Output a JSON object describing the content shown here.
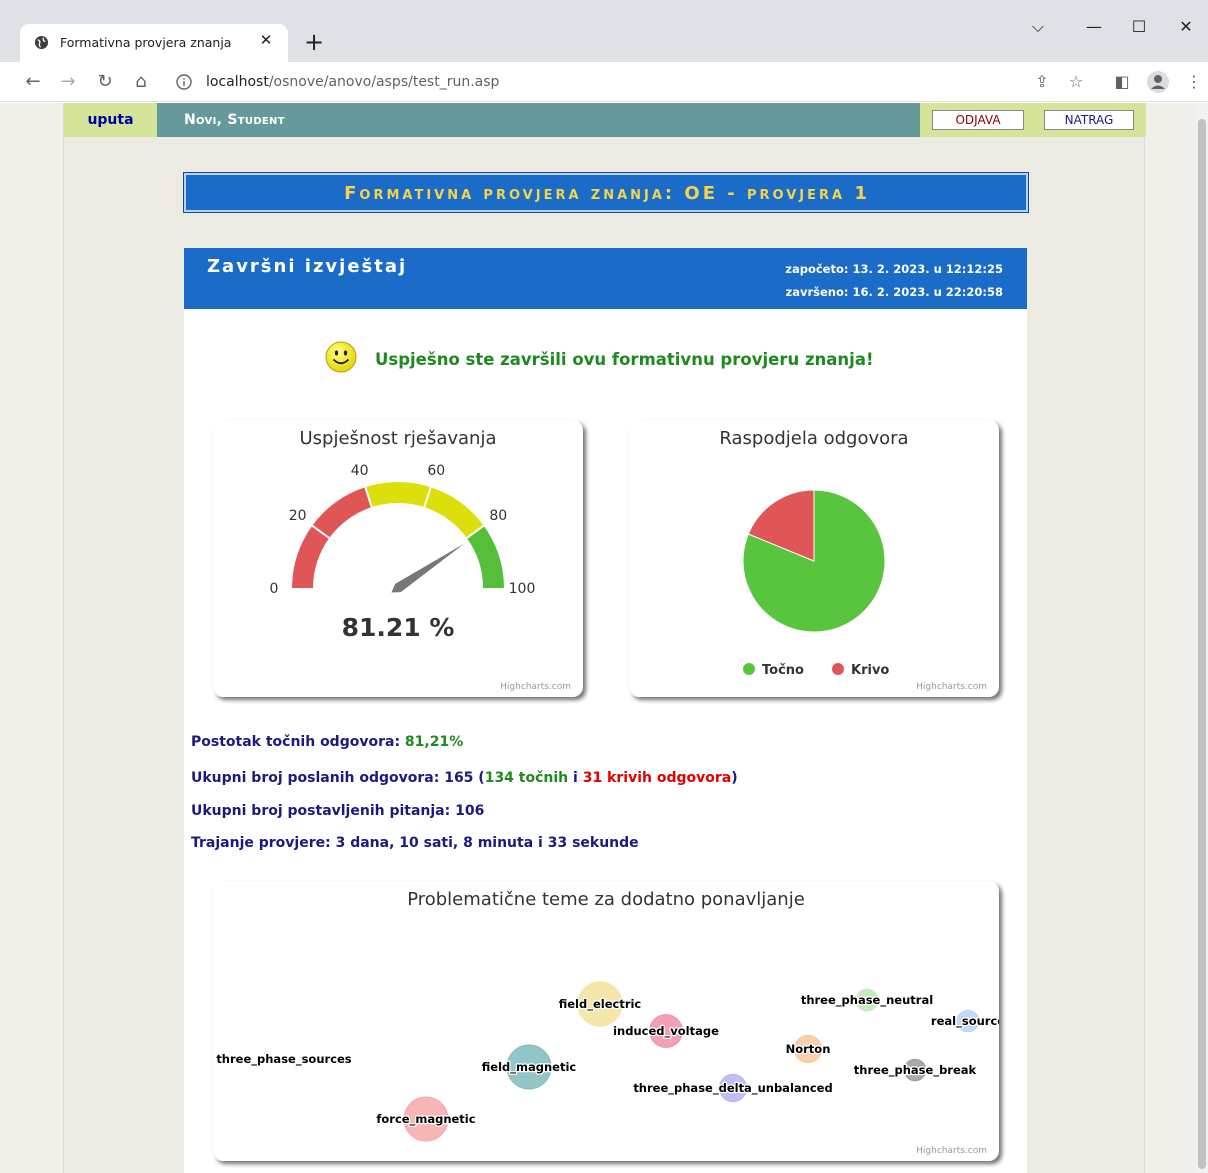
{
  "browser": {
    "tab_title": "Formativna provjera znanja",
    "url_host": "localhost",
    "url_path": "/osnove/anovo/asps/test_run.asp"
  },
  "nav": {
    "uputa": "uputa",
    "user": "Novi, Student",
    "odjava": "ODJAVA",
    "natrag": "NATRAG"
  },
  "banner": "Formativna provjera znanja: OE - provjera 1",
  "report": {
    "title": "Završni izvještaj",
    "started": "započeto: 13. 2. 2023. u 12:12:25",
    "finished": "završeno: 16. 2. 2023. u 22:20:58",
    "success_message": "Uspješno ste završili ovu formativnu provjeru znanja!",
    "stats": {
      "pct_label": "Postotak točnih odgovora: ",
      "pct_value": "81,21%",
      "sent_label": "Ukupni broj poslanih odgovora: 165 (",
      "sent_correct": "134 točnih",
      "sent_mid": " i ",
      "sent_wrong": "31 krivih odgovora",
      "sent_end": ")",
      "questions": "Ukupni broj postavljenih pitanja: 106",
      "duration": "Trajanje provjere: 3 dana, 10 sati, 8 minuta i 33 sekunde"
    }
  },
  "credits": "Highcharts.com",
  "chart_data": [
    {
      "type": "gauge",
      "title": "Uspješnost rješavanja",
      "value": 81.21,
      "value_label": "81.21 %",
      "min": 0,
      "max": 100,
      "ticks": [
        "0",
        "20",
        "40",
        "60",
        "80",
        "100"
      ],
      "bands": [
        {
          "from": 0,
          "to": 40,
          "color": "#e05555"
        },
        {
          "from": 40,
          "to": 80,
          "color": "#dddf0d"
        },
        {
          "from": 80,
          "to": 100,
          "color": "#55bf3b"
        }
      ]
    },
    {
      "type": "pie",
      "title": "Raspodjela odgovora",
      "slices": [
        {
          "name": "Točno",
          "value": 134,
          "color": "#59c43d"
        },
        {
          "name": "Krivo",
          "value": 31,
          "color": "#e05555"
        }
      ]
    },
    {
      "type": "packed-bubble",
      "title": "Problematične teme za dodatno ponavljanje",
      "bubbles": [
        {
          "name": "three_phase_sources",
          "value": 0,
          "color": "#ffffff"
        },
        {
          "name": "force_magnetic",
          "value": 5,
          "color": "#f7a8aa"
        },
        {
          "name": "field_magnetic",
          "value": 5,
          "color": "#7fbcbc"
        },
        {
          "name": "field_electric",
          "value": 5,
          "color": "#f2e39a"
        },
        {
          "name": "induced_voltage",
          "value": 3,
          "color": "#f08fa8"
        },
        {
          "name": "three_phase_delta_unbalanced",
          "value": 2,
          "color": "#b4b4f2"
        },
        {
          "name": "Norton",
          "value": 2,
          "color": "#f8c898"
        },
        {
          "name": "three_phase_neutral",
          "value": 1,
          "color": "#bde8b4"
        },
        {
          "name": "real_source",
          "value": 1,
          "color": "#b8d4f2"
        },
        {
          "name": "three_phase_break",
          "value": 1,
          "color": "#9a9a9a"
        }
      ]
    }
  ]
}
